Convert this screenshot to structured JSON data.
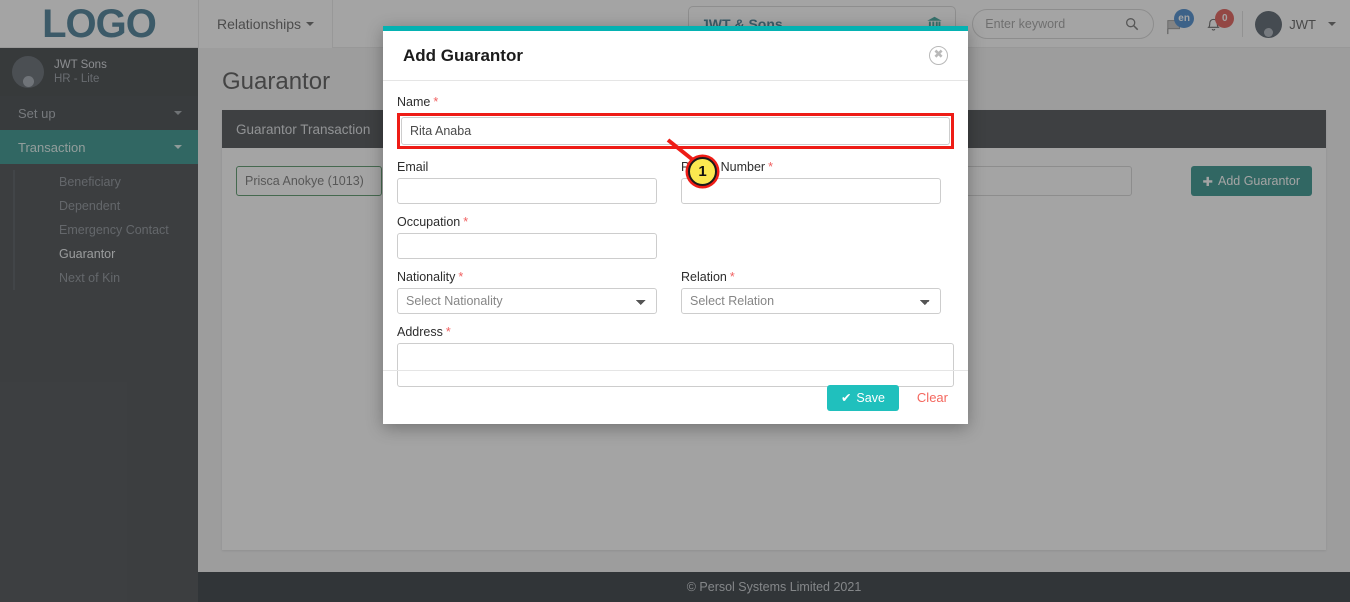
{
  "navbar": {
    "logo_text": "LOGO",
    "menu": [
      {
        "label": "Relationships",
        "icon": "chevron-down-icon"
      }
    ],
    "company": {
      "name": "JWT & Sons",
      "icon": "bank-icon"
    },
    "search": {
      "placeholder": "Enter keyword",
      "value": "",
      "icon": "search-icon"
    },
    "language_badge": "en",
    "notification_badge": "0",
    "user": {
      "name": "JWT",
      "icon": "chevron-down-icon"
    }
  },
  "sidebar": {
    "user": {
      "name": "JWT Sons",
      "role": "HR - Lite"
    },
    "items": [
      {
        "label": "Set up",
        "active": false,
        "icon": "chevron-down-icon"
      },
      {
        "label": "Transaction",
        "active": true,
        "icon": "chevron-down-icon"
      }
    ],
    "sub_items": [
      {
        "label": "Beneficiary",
        "active": false
      },
      {
        "label": "Dependent",
        "active": false
      },
      {
        "label": "Emergency Contact",
        "active": false
      },
      {
        "label": "Guarantor",
        "active": true
      },
      {
        "label": "Next of Kin",
        "active": false
      }
    ]
  },
  "main": {
    "page_title": "Guarantor",
    "card_header": "Guarantor Transaction",
    "employee_value": "Prisca Anokye (1013)",
    "secondary_value": "",
    "add_button": {
      "label": "Add Guarantor",
      "icon": "plus-icon"
    }
  },
  "footer": {
    "text": "© Persol Systems Limited 2021"
  },
  "modal": {
    "title": "Add Guarantor",
    "close_icon": "close-circle-icon",
    "fields": {
      "name": {
        "label": "Name",
        "required": true,
        "value": "Rita Anaba",
        "highlighted": true
      },
      "email": {
        "label": "Email",
        "required": false,
        "value": ""
      },
      "phone": {
        "label": "Phone Number",
        "required": true,
        "value": ""
      },
      "occupation": {
        "label": "Occupation",
        "required": true,
        "value": ""
      },
      "nationality": {
        "label": "Nationality",
        "required": true,
        "value": "Select Nationality"
      },
      "relation": {
        "label": "Relation",
        "required": true,
        "value": "Select Relation"
      },
      "address": {
        "label": "Address",
        "required": true,
        "value": ""
      }
    },
    "save_label": "Save",
    "save_icon": "check-icon",
    "clear_label": "Clear"
  },
  "annotation": {
    "step_number": "1",
    "color": "#ee1c16",
    "fill": "#fbe850"
  },
  "colors": {
    "accent_teal": "#00786f",
    "modal_top": "#05b2b2",
    "save_button": "#20c0bd",
    "required_star": "#f06060",
    "annotation_red": "#ee1c16"
  }
}
